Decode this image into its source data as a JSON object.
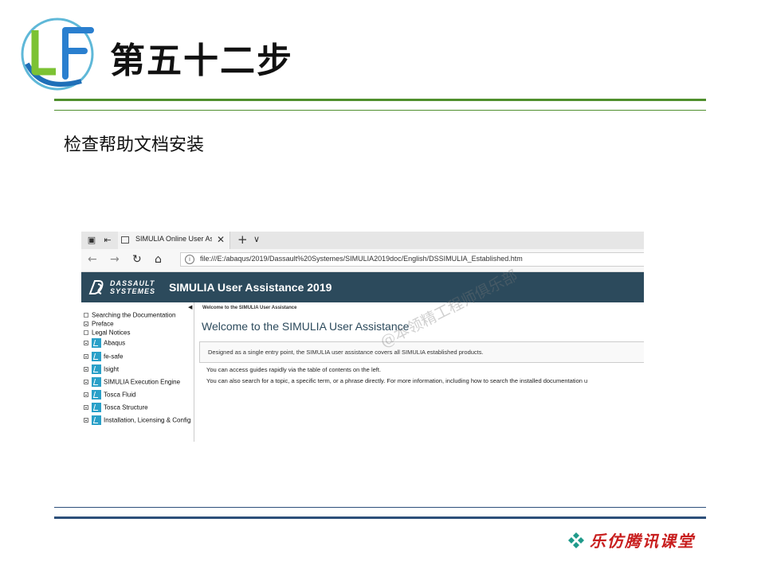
{
  "slide": {
    "title": "第五十二步",
    "subtitle": "检查帮助文档安装",
    "footer_brand": "乐仿腾讯课堂",
    "watermark": "@本领精工程师俱乐部",
    "logo_icon": "lf-logo-icon"
  },
  "browser": {
    "tab_title": "SIMULIA Online User As",
    "tab_close": "✕",
    "new_tab": "+",
    "tab_menu": "∨",
    "address": "file:///E:/abaqus/2019/Dassault%20Systemes/SIMULIA2019doc/English/DSSIMULIA_Established.htm",
    "nav": {
      "back": "←",
      "forward": "→",
      "refresh": "↻",
      "home": "⌂",
      "info": "i"
    }
  },
  "banner": {
    "brand_line1": "DASSAULT",
    "brand_line2": "SYSTEMES",
    "title": "SIMULIA User Assistance 2019",
    "colors": {
      "background": "#2c4a5c"
    }
  },
  "toc": {
    "collapse_glyph": "◀",
    "items": [
      {
        "label": "Searching the Documentation",
        "marker": "square"
      },
      {
        "label": "Preface",
        "marker": "plus"
      },
      {
        "label": "Legal Notices",
        "marker": "square"
      },
      {
        "label": "Abaqus",
        "marker": "plus",
        "book": true
      },
      {
        "label": "fe-safe",
        "marker": "plus",
        "book": true
      },
      {
        "label": "Isight",
        "marker": "plus",
        "book": true
      },
      {
        "label": "SIMULIA Execution Engine",
        "marker": "plus",
        "book": true
      },
      {
        "label": "Tosca Fluid",
        "marker": "plus",
        "book": true
      },
      {
        "label": "Tosca Structure",
        "marker": "plus",
        "book": true
      },
      {
        "label": "Installation, Licensing & Config",
        "marker": "plus",
        "book": true
      }
    ]
  },
  "content": {
    "breadcrumb": "Welcome to the SIMULIA User Assistance",
    "title": "Welcome to the SIMULIA User Assistance",
    "note": "Designed as a single entry point, the SIMULIA user assistance covers all SIMULIA established products.",
    "paragraphs": [
      "You can access guides rapidly via the table of contents on the left.",
      "You can also search for a topic, a specific term, or a phrase directly. For more information, including how to search the installed documentation u"
    ]
  },
  "colors": {
    "accent_green": "#4f8f2d",
    "accent_blue": "#2d4f7a",
    "footer_red": "#c81e1e"
  }
}
